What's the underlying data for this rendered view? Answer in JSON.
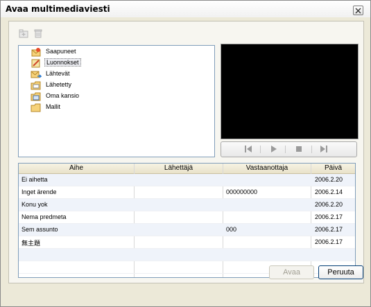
{
  "window": {
    "title": "Avaa multimediaviesti"
  },
  "toolbar": {
    "new_icon": "new-folder-icon",
    "delete_icon": "trash-icon"
  },
  "folders": [
    {
      "label": "Saapuneet",
      "icon": "inbox-icon",
      "selected": false
    },
    {
      "label": "Luonnokset",
      "icon": "drafts-icon",
      "selected": true
    },
    {
      "label": "Lähtevät",
      "icon": "outbox-icon",
      "selected": false
    },
    {
      "label": "Lähetetty",
      "icon": "sent-icon",
      "selected": false
    },
    {
      "label": "Oma kansio",
      "icon": "my-folder-icon",
      "selected": false
    },
    {
      "label": "Mallit",
      "icon": "templates-folder-icon",
      "selected": false
    }
  ],
  "player": {
    "controls": [
      "previous-icon",
      "play-icon",
      "stop-icon",
      "next-icon"
    ]
  },
  "table": {
    "columns": [
      "Aihe",
      "Lähettäjä",
      "Vastaanottaja",
      "Päivä"
    ],
    "rows": [
      {
        "subject": "Ei aihetta",
        "sender": "",
        "recipient": "",
        "date": "2006.2.20"
      },
      {
        "subject": "Inget ärende",
        "sender": "",
        "recipient": "000000000",
        "date": "2006.2.14"
      },
      {
        "subject": "Konu yok",
        "sender": "",
        "recipient": "",
        "date": "2006.2.20"
      },
      {
        "subject": "Nema predmeta",
        "sender": "",
        "recipient": "",
        "date": "2006.2.17"
      },
      {
        "subject": "Sem assunto",
        "sender": "",
        "recipient": "000",
        "date": "2006.2.17"
      },
      {
        "subject": "無主題",
        "sender": "",
        "recipient": "",
        "date": "2006.2.17"
      }
    ]
  },
  "buttons": {
    "open": "Avaa",
    "cancel": "Peruuta"
  }
}
